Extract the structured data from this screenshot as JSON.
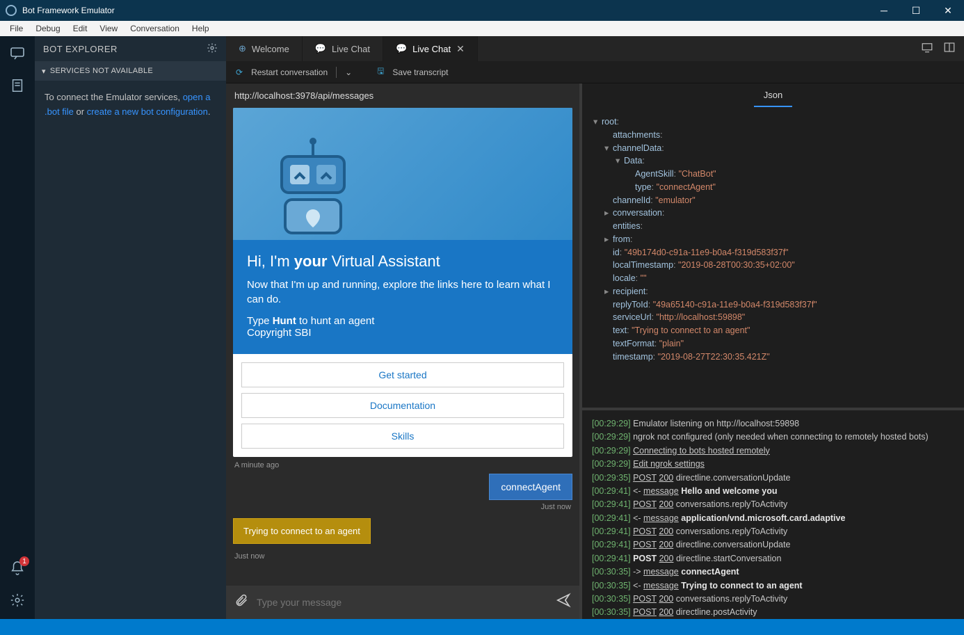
{
  "window": {
    "title": "Bot Framework Emulator"
  },
  "menu": [
    "File",
    "Debug",
    "Edit",
    "View",
    "Conversation",
    "Help"
  ],
  "sidebar": {
    "title": "BOT EXPLORER",
    "section": "SERVICES NOT AVAILABLE",
    "txt1": "To connect the Emulator services, ",
    "link1": "open a .bot file",
    "txt2": " or ",
    "link2": "create a new bot configuration",
    "txt3": "."
  },
  "tabs": {
    "t0": "Welcome",
    "t1": "Live Chat",
    "t2": "Live Chat"
  },
  "toolbar": {
    "restart": "Restart conversation",
    "save": "Save transcript"
  },
  "chat": {
    "url": "http://localhost:3978/api/messages",
    "card_h_pre": "Hi, I'm ",
    "card_h_b": "your",
    "card_h_post": " Virtual Assistant",
    "card_p": "Now that I'm up and running, explore the links here to learn what I can do.",
    "card_l1_pre": "Type ",
    "card_l1_b": "Hunt",
    "card_l1_post": " to hunt an agent",
    "card_l2": "Copyright SBI",
    "btn1": "Get started",
    "btn2": "Documentation",
    "btn3": "Skills",
    "ts_card": "A minute ago",
    "user_msg": "connectAgent",
    "ts_user": "Just now",
    "sys_msg": "Trying to connect to an agent",
    "ts_sys": "Just now",
    "placeholder": "Type your message"
  },
  "inspector": {
    "tab": "Json"
  },
  "json": [
    {
      "i": 0,
      "c": "▾",
      "k": "root",
      "v": ""
    },
    {
      "i": 1,
      "c": "",
      "k": "attachments",
      "v": ""
    },
    {
      "i": 1,
      "c": "▾",
      "k": "channelData",
      "v": ""
    },
    {
      "i": 2,
      "c": "▾",
      "k": "Data",
      "v": ""
    },
    {
      "i": 3,
      "c": "",
      "k": "AgentSkill",
      "v": "\"ChatBot\""
    },
    {
      "i": 3,
      "c": "",
      "k": "type",
      "v": "\"connectAgent\""
    },
    {
      "i": 1,
      "c": "",
      "k": "channelId",
      "v": "\"emulator\""
    },
    {
      "i": 1,
      "c": "▸",
      "k": "conversation",
      "v": ""
    },
    {
      "i": 1,
      "c": "",
      "k": "entities",
      "v": ""
    },
    {
      "i": 1,
      "c": "▸",
      "k": "from",
      "v": ""
    },
    {
      "i": 1,
      "c": "",
      "k": "id",
      "v": "\"49b174d0-c91a-11e9-b0a4-f319d583f37f\""
    },
    {
      "i": 1,
      "c": "",
      "k": "localTimestamp",
      "v": "\"2019-08-28T00:30:35+02:00\""
    },
    {
      "i": 1,
      "c": "",
      "k": "locale",
      "v": "\"\""
    },
    {
      "i": 1,
      "c": "▸",
      "k": "recipient",
      "v": ""
    },
    {
      "i": 1,
      "c": "",
      "k": "replyToId",
      "v": "\"49a65140-c91a-11e9-b0a4-f319d583f37f\""
    },
    {
      "i": 1,
      "c": "",
      "k": "serviceUrl",
      "v": "\"http://localhost:59898\""
    },
    {
      "i": 1,
      "c": "",
      "k": "text",
      "v": "\"Trying to connect to an agent\""
    },
    {
      "i": 1,
      "c": "",
      "k": "textFormat",
      "v": "\"plain\""
    },
    {
      "i": 1,
      "c": "",
      "k": "timestamp",
      "v": "\"2019-08-27T22:30:35.421Z\""
    }
  ],
  "log": [
    {
      "t": "[00:29:29]",
      "parts": [
        {
          "txt": "Emulator listening on http://localhost:59898"
        }
      ]
    },
    {
      "t": "[00:29:29]",
      "parts": [
        {
          "txt": "ngrok not configured (only needed when connecting to remotely hosted bots)"
        }
      ]
    },
    {
      "t": "[00:29:29]",
      "parts": [
        {
          "link": "Connecting to bots hosted remotely"
        }
      ]
    },
    {
      "t": "[00:29:29]",
      "parts": [
        {
          "link": "Edit ngrok settings"
        }
      ]
    },
    {
      "t": "[00:29:35]",
      "parts": [
        {
          "verb": "POST"
        },
        {
          "code": "200"
        },
        {
          "txt": "directline.conversationUpdate"
        }
      ]
    },
    {
      "t": "[00:29:41]",
      "parts": [
        {
          "txt": "<- "
        },
        {
          "verb": "message"
        },
        {
          "b": "Hello and welcome you"
        }
      ]
    },
    {
      "t": "[00:29:41]",
      "parts": [
        {
          "verb": "POST"
        },
        {
          "code": "200"
        },
        {
          "txt": "conversations.replyToActivity"
        }
      ]
    },
    {
      "t": "[00:29:41]",
      "parts": [
        {
          "txt": "<- "
        },
        {
          "verb": "message"
        },
        {
          "b": "application/vnd.microsoft.card.adaptive"
        }
      ]
    },
    {
      "t": "[00:29:41]",
      "parts": [
        {
          "verb": "POST"
        },
        {
          "code": "200"
        },
        {
          "txt": "conversations.replyToActivity"
        }
      ]
    },
    {
      "t": "[00:29:41]",
      "parts": [
        {
          "verb": "POST"
        },
        {
          "code": "200"
        },
        {
          "txt": "directline.conversationUpdate"
        }
      ]
    },
    {
      "t": "[00:29:41]",
      "parts": [
        {
          "b": "POST "
        },
        {
          "code": "200"
        },
        {
          "txt": "directline.startConversation"
        }
      ]
    },
    {
      "t": "[00:30:35]",
      "parts": [
        {
          "txt": "-> "
        },
        {
          "verb": "message"
        },
        {
          "b": "connectAgent"
        }
      ]
    },
    {
      "t": "[00:30:35]",
      "parts": [
        {
          "txt": "<- "
        },
        {
          "verb": "message"
        },
        {
          "b": "Trying to connect to an agent"
        }
      ]
    },
    {
      "t": "[00:30:35]",
      "parts": [
        {
          "verb": "POST"
        },
        {
          "code": "200"
        },
        {
          "txt": "conversations.replyToActivity"
        }
      ]
    },
    {
      "t": "[00:30:35]",
      "parts": [
        {
          "verb": "POST"
        },
        {
          "code": "200"
        },
        {
          "txt": "directline.postActivity"
        }
      ]
    }
  ],
  "notif_count": "1"
}
